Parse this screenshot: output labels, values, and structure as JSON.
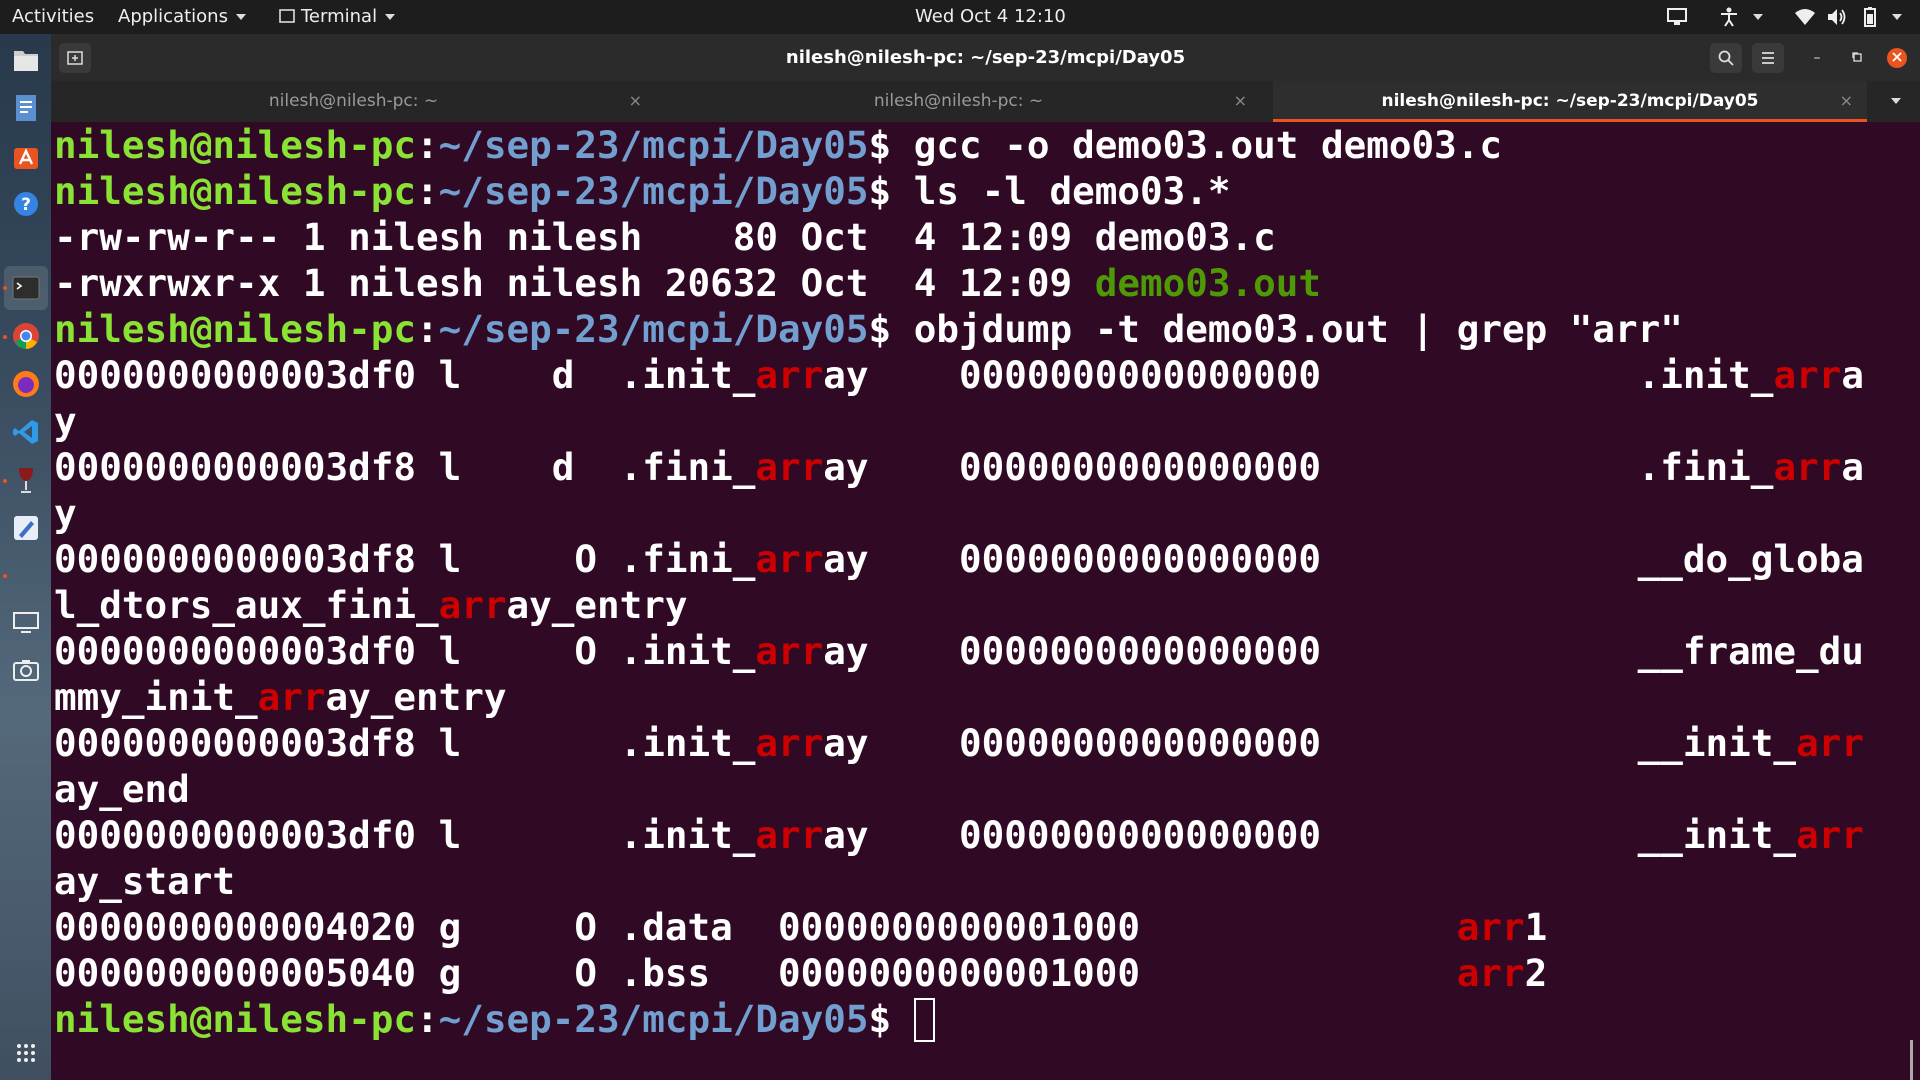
{
  "topbar": {
    "activities": "Activities",
    "applications": "Applications",
    "terminal_menu": "Terminal",
    "datetime": "Wed Oct 4  12:10"
  },
  "dock": {
    "apps": [
      "files-icon",
      "text-editor-icon",
      "software-center-icon",
      "help-icon",
      "terminal-icon",
      "chrome-icon",
      "firefox-icon",
      "vscode-icon",
      "wine-icon",
      "text-app-icon",
      "display-icon",
      "camera-icon"
    ],
    "show_apps": "show-applications-icon"
  },
  "window": {
    "title": "nilesh@nilesh-pc: ~/sep-23/mcpi/Day05",
    "tabs": [
      {
        "label": "nilesh@nilesh-pc: ~",
        "close": "×"
      },
      {
        "label": "nilesh@nilesh-pc: ~",
        "close": "×"
      },
      {
        "label": "nilesh@nilesh-pc: ~/sep-23/mcpi/Day05",
        "close": "×"
      }
    ]
  },
  "terminal": {
    "prompt_user": "nilesh@nilesh-pc",
    "prompt_colon": ":",
    "prompt_path": "~/sep-23/mcpi/Day05",
    "prompt_dollar": "$",
    "cmd1": " gcc -o demo03.out demo03.c",
    "cmd2": " ls -l demo03.*",
    "ls1": "-rw-rw-r-- 1 nilesh nilesh    80 Oct  4 12:09 demo03.c",
    "ls2_prefix": "-rwxrwxr-x 1 nilesh nilesh 20632 Oct  4 12:09 ",
    "ls2_file": "demo03.out",
    "cmd3": " objdump -t demo03.out | grep \"arr\"",
    "match": "arr",
    "rows": [
      {
        "a": "0000000000003df0 l    d  .init_",
        "b": "ay    0000000000000000              .init_",
        "c": "a"
      },
      {
        "a": "y"
      },
      {
        "a": "0000000000003df8 l    d  .fini_",
        "b": "ay    0000000000000000              .fini_",
        "c": "a"
      },
      {
        "a": "y"
      },
      {
        "a": "0000000000003df8 l     O .fini_",
        "b": "ay    0000000000000000              __do_globa"
      },
      {
        "a": "l_dtors_aux_fini_",
        "b": "ay_entry"
      },
      {
        "a": "0000000000003df0 l     O .init_",
        "b": "ay    0000000000000000              __frame_du"
      },
      {
        "a": "mmy_init_",
        "b": "ay_entry"
      },
      {
        "a": "0000000000003df8 l       .init_",
        "b": "ay    0000000000000000              __init_"
      },
      {
        "a": "ay_end"
      },
      {
        "a": "0000000000003df0 l       .init_",
        "b": "ay    0000000000000000              __init_"
      },
      {
        "a": "ay_start"
      },
      {
        "a": "0000000000004020 g     O .data  0000000000001000              ",
        "b": "1"
      },
      {
        "a": "0000000000005040 g     O .bss   0000000000001000              ",
        "b": "2"
      }
    ]
  }
}
